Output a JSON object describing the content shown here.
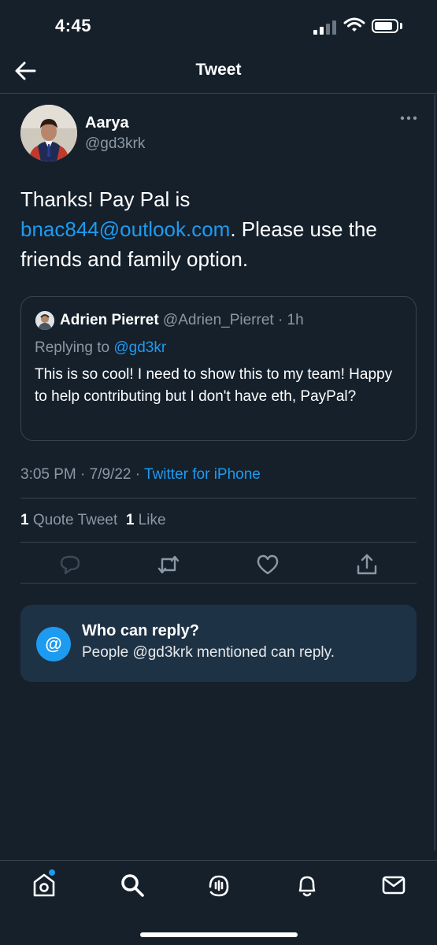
{
  "status_bar": {
    "time": "4:45"
  },
  "header": {
    "title": "Tweet"
  },
  "tweet": {
    "author_name": "Aarya",
    "author_handle": "@gd3krk",
    "text_before_link": "Thanks! Pay Pal is ",
    "link_text": "bnac844@outlook.com",
    "text_after_link": ". Please use the friends and family option.",
    "timestamp": "3:05 PM · 7/9/22 · ",
    "source": "Twitter for iPhone",
    "quote_tweet_count": "1",
    "quote_tweet_label": "Quote Tweet",
    "like_count": "1",
    "like_label": "Like"
  },
  "quoted": {
    "name": "Adrien Pierret",
    "handle_time": " @Adrien_Pierret · 1h",
    "replying_prefix": "Replying to ",
    "replying_handle": "@gd3kr",
    "text": "This is so cool! I need to show this to my team! Happy to help contributing but I don't have eth, PayPal?"
  },
  "reply_settings": {
    "icon": "@",
    "title": "Who can reply?",
    "subtitle": "People @gd3krk mentioned can reply."
  },
  "colors": {
    "background": "#15202b",
    "accent": "#1d9bf0",
    "muted": "#8b98a5",
    "card": "#1e3246"
  },
  "icons": [
    "back-arrow-icon",
    "more-icon",
    "reply-icon",
    "retweet-icon",
    "like-icon",
    "share-icon",
    "home-icon",
    "search-icon",
    "spaces-icon",
    "notifications-icon",
    "messages-icon"
  ]
}
